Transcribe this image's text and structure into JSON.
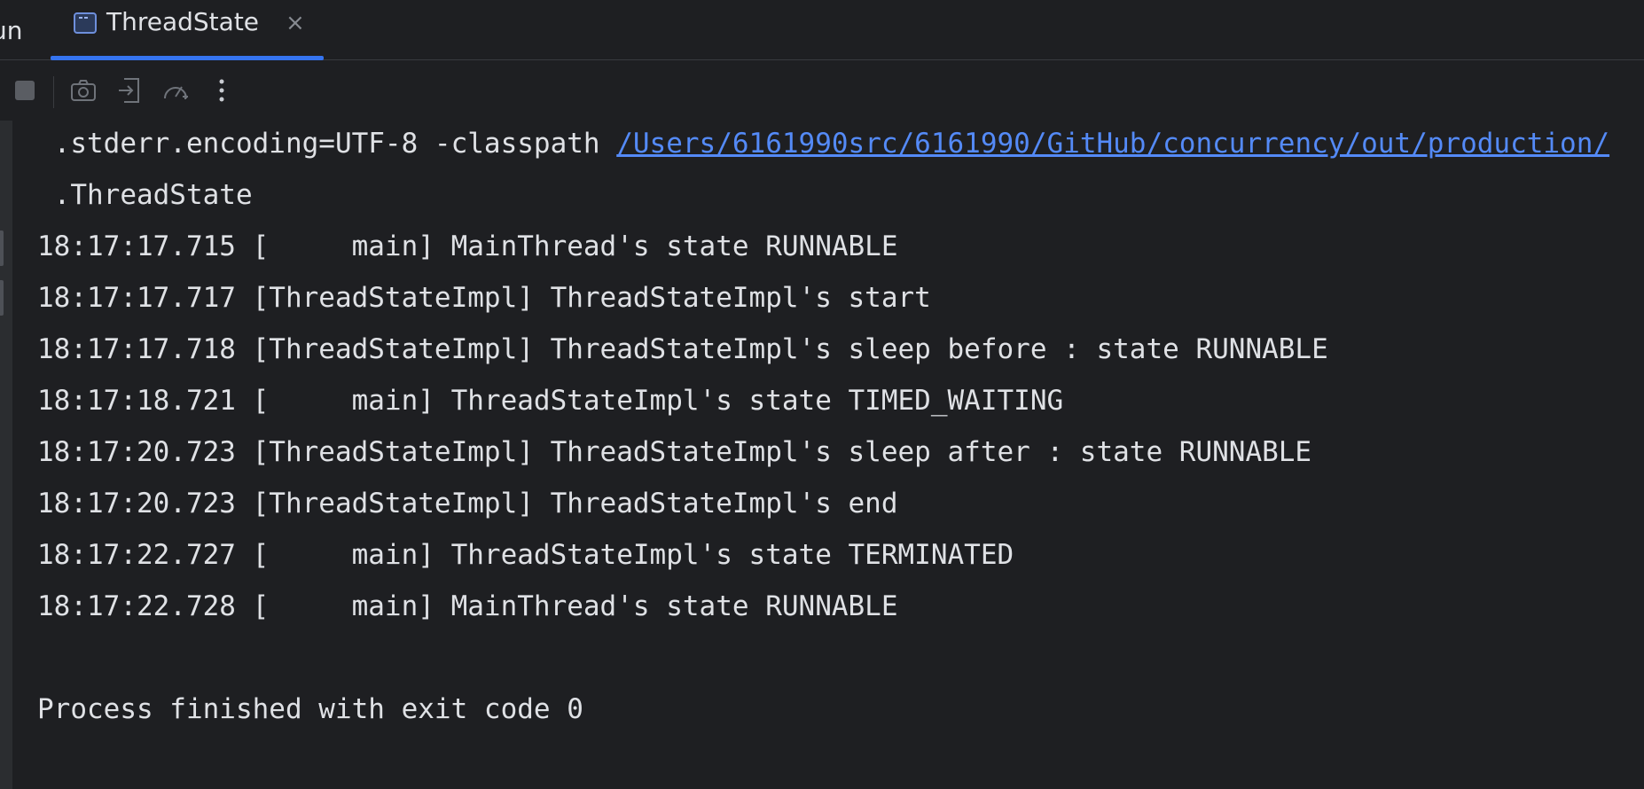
{
  "tabs": {
    "run_partial_label": "un",
    "active": {
      "title": "ThreadState",
      "icon": "console-icon",
      "close_glyph": "×"
    }
  },
  "toolbar": {
    "buttons": [
      {
        "name": "stop-button",
        "icon": "stop-icon"
      },
      {
        "name": "screenshot-button",
        "icon": "camera-icon"
      },
      {
        "name": "exit-button",
        "icon": "exit-icon"
      },
      {
        "name": "profiler-button",
        "icon": "gauge-icon"
      },
      {
        "name": "more-button",
        "icon": "more-vertical-icon"
      }
    ]
  },
  "console": {
    "cmd_prefix": " .stderr.encoding=UTF-8 -classpath ",
    "classpath_link": "/Users/6161990src/6161990/GitHub/concurrency/out/production/",
    "cmd_class": " .ThreadState",
    "lines": [
      "18:17:17.715 [     main] MainThread's state RUNNABLE",
      "18:17:17.717 [ThreadStateImpl] ThreadStateImpl's start",
      "18:17:17.718 [ThreadStateImpl] ThreadStateImpl's sleep before : state RUNNABLE",
      "18:17:18.721 [     main] ThreadStateImpl's state TIMED_WAITING",
      "18:17:20.723 [ThreadStateImpl] ThreadStateImpl's sleep after : state RUNNABLE",
      "18:17:20.723 [ThreadStateImpl] ThreadStateImpl's end",
      "18:17:22.727 [     main] ThreadStateImpl's state TERMINATED",
      "18:17:22.728 [     main] MainThread's state RUNNABLE"
    ],
    "exit_message": "Process finished with exit code 0"
  },
  "colors": {
    "background": "#1e1f22",
    "accent": "#3574f0",
    "link": "#548af7",
    "text": "#dfe1e5"
  }
}
